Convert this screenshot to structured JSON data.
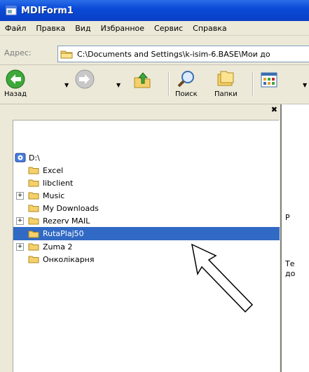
{
  "window": {
    "title": "MDIForm1"
  },
  "menu": {
    "items": [
      "Файл",
      "Правка",
      "Вид",
      "Избранное",
      "Сервис",
      "Справка"
    ]
  },
  "address": {
    "label": "Адрес:",
    "path": "C:\\Documents and Settings\\k-isim-6.BASE\\Мои до"
  },
  "toolbar": {
    "back": "Назад",
    "search": "Поиск",
    "folders": "Папки"
  },
  "tree": {
    "root": "D:\\",
    "items": [
      {
        "label": "Excel",
        "expandable": false,
        "selected": false
      },
      {
        "label": "libclient",
        "expandable": false,
        "selected": false
      },
      {
        "label": "Music",
        "expandable": true,
        "selected": false
      },
      {
        "label": "My Downloads",
        "expandable": false,
        "selected": false
      },
      {
        "label": "Rezerv MAIL",
        "expandable": true,
        "selected": false
      },
      {
        "label": "RutaPlaj50",
        "expandable": false,
        "selected": true
      },
      {
        "label": "Zuma 2",
        "expandable": true,
        "selected": false
      },
      {
        "label": "Онколікарня",
        "expandable": false,
        "selected": false
      }
    ]
  },
  "rightpane": {
    "t1": "Р",
    "t2": "Те",
    "t3": "до"
  },
  "colors": {
    "title": "#0a4bd8",
    "selection": "#316ac5",
    "folder": "#f5d06a"
  }
}
